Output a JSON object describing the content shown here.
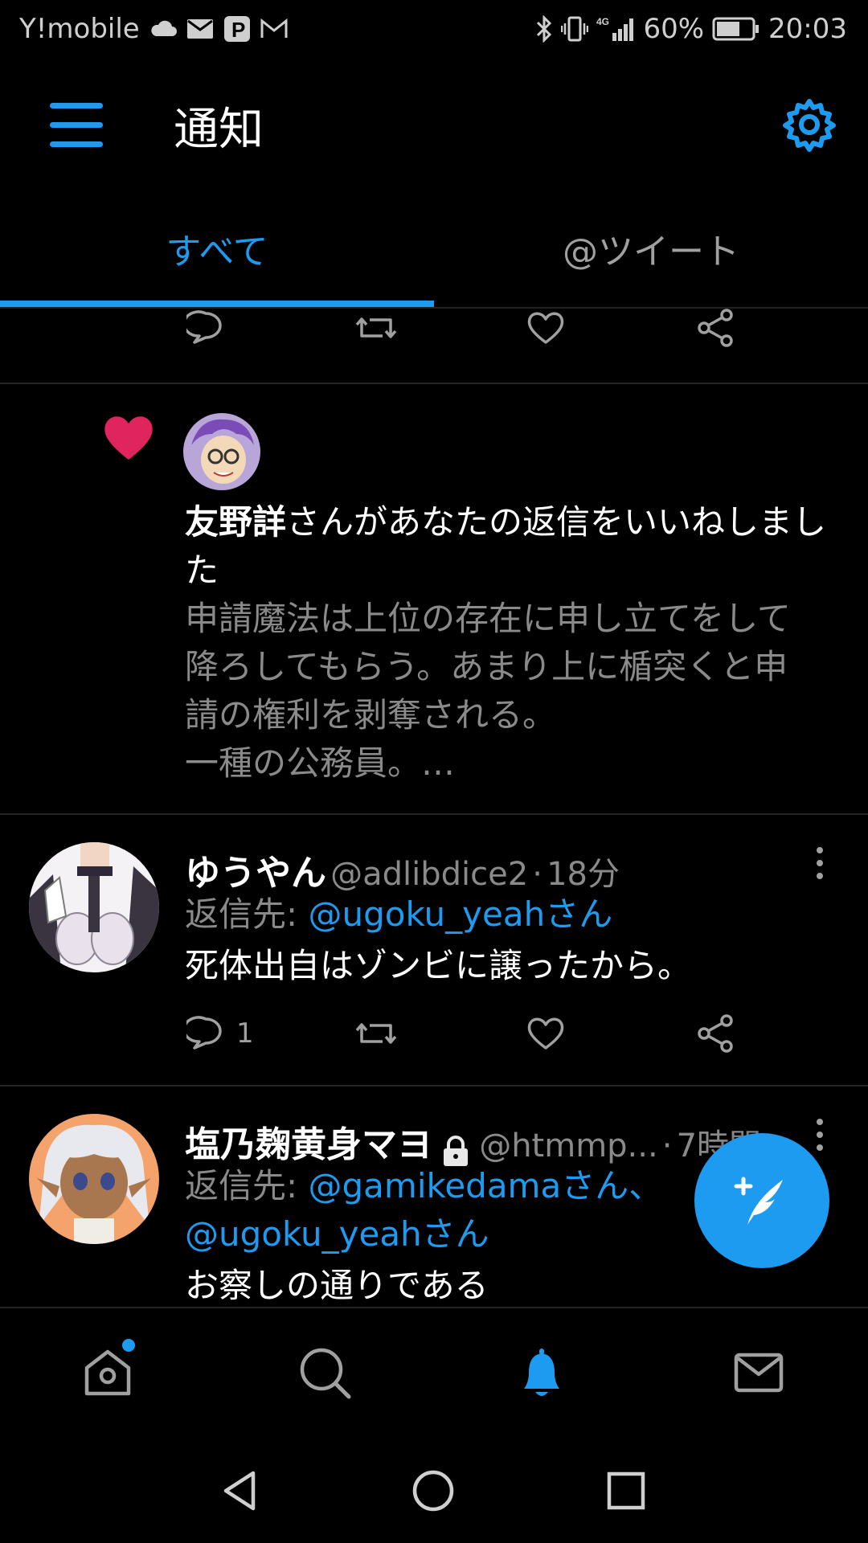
{
  "status_bar": {
    "carrier": "Y!mobile",
    "battery": "60%",
    "time": "20:03",
    "network": "4G"
  },
  "header": {
    "title": "通知"
  },
  "tabs": {
    "all": "すべて",
    "mentions": "@ツイート"
  },
  "notification": {
    "liker_name": "友野詳",
    "action_text": "さんがあなたの返信をいいねしました",
    "quoted_lines": [
      "申請魔法は上位の存在に申し立てをして",
      "降ろしてもらう。あまり上に楯突くと申",
      "請の権利を剥奪される。",
      "一種の公務員。…"
    ]
  },
  "tweets": [
    {
      "display_name": "ゆうやん",
      "handle": "@adlibdice2",
      "separator": "·",
      "time": "18分",
      "reply_prefix": "返信先: ",
      "reply_to": "@ugoku_yeahさん",
      "text": "死体出自はゾンビに譲ったから。",
      "reply_count": "1"
    },
    {
      "display_name": "塩乃麹黄身マヨ",
      "handle": "@htmmp...",
      "separator": "·",
      "time": "7時間",
      "reply_prefix": "返信先: ",
      "reply_to_1": "@gamikedamaさん、",
      "reply_to_2": "@ugoku_yeahさん",
      "text": "お察しの通りである"
    }
  ],
  "colors": {
    "accent": "#1d9bf0",
    "like": "#e0245e",
    "background": "#000000",
    "secondary_text": "#8a8a8a"
  },
  "icons": {
    "menu": "hamburger-menu-icon",
    "settings": "gear-icon",
    "reply": "reply-icon",
    "retweet": "retweet-icon",
    "like": "heart-icon",
    "share": "share-icon",
    "lock": "lock-icon",
    "compose": "compose-tweet-icon",
    "home": "home-icon",
    "search": "search-icon",
    "notifications": "bell-icon",
    "messages": "mail-icon"
  }
}
